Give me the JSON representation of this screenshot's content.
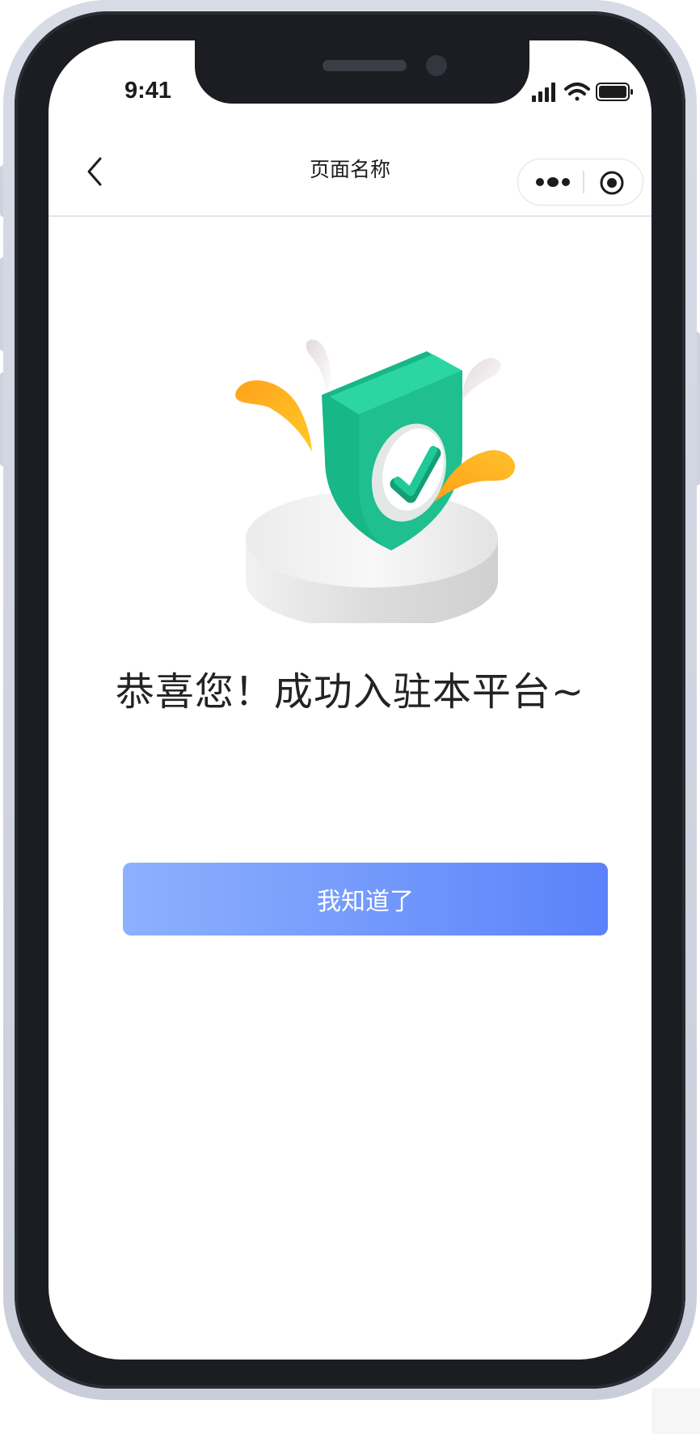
{
  "status_bar": {
    "time": "9:41",
    "icons": [
      "signal-icon",
      "wifi-icon",
      "battery-icon"
    ]
  },
  "nav": {
    "title": "页面名称",
    "back_icon": "chevron-left-icon",
    "more_icon": "more-dots-icon",
    "close_icon": "capsule-close-icon"
  },
  "content": {
    "illustration_icon": "shield-check-icon",
    "message": "恭喜您！成功入驻本平台~",
    "button_label": "我知道了"
  },
  "colors": {
    "button_gradient_start": "#8db1fd",
    "button_gradient_end": "#5b82fa",
    "shield_green": "#1fbf8f",
    "accent_orange": "#ffb21c",
    "phone_frame": "#1c1d22"
  }
}
